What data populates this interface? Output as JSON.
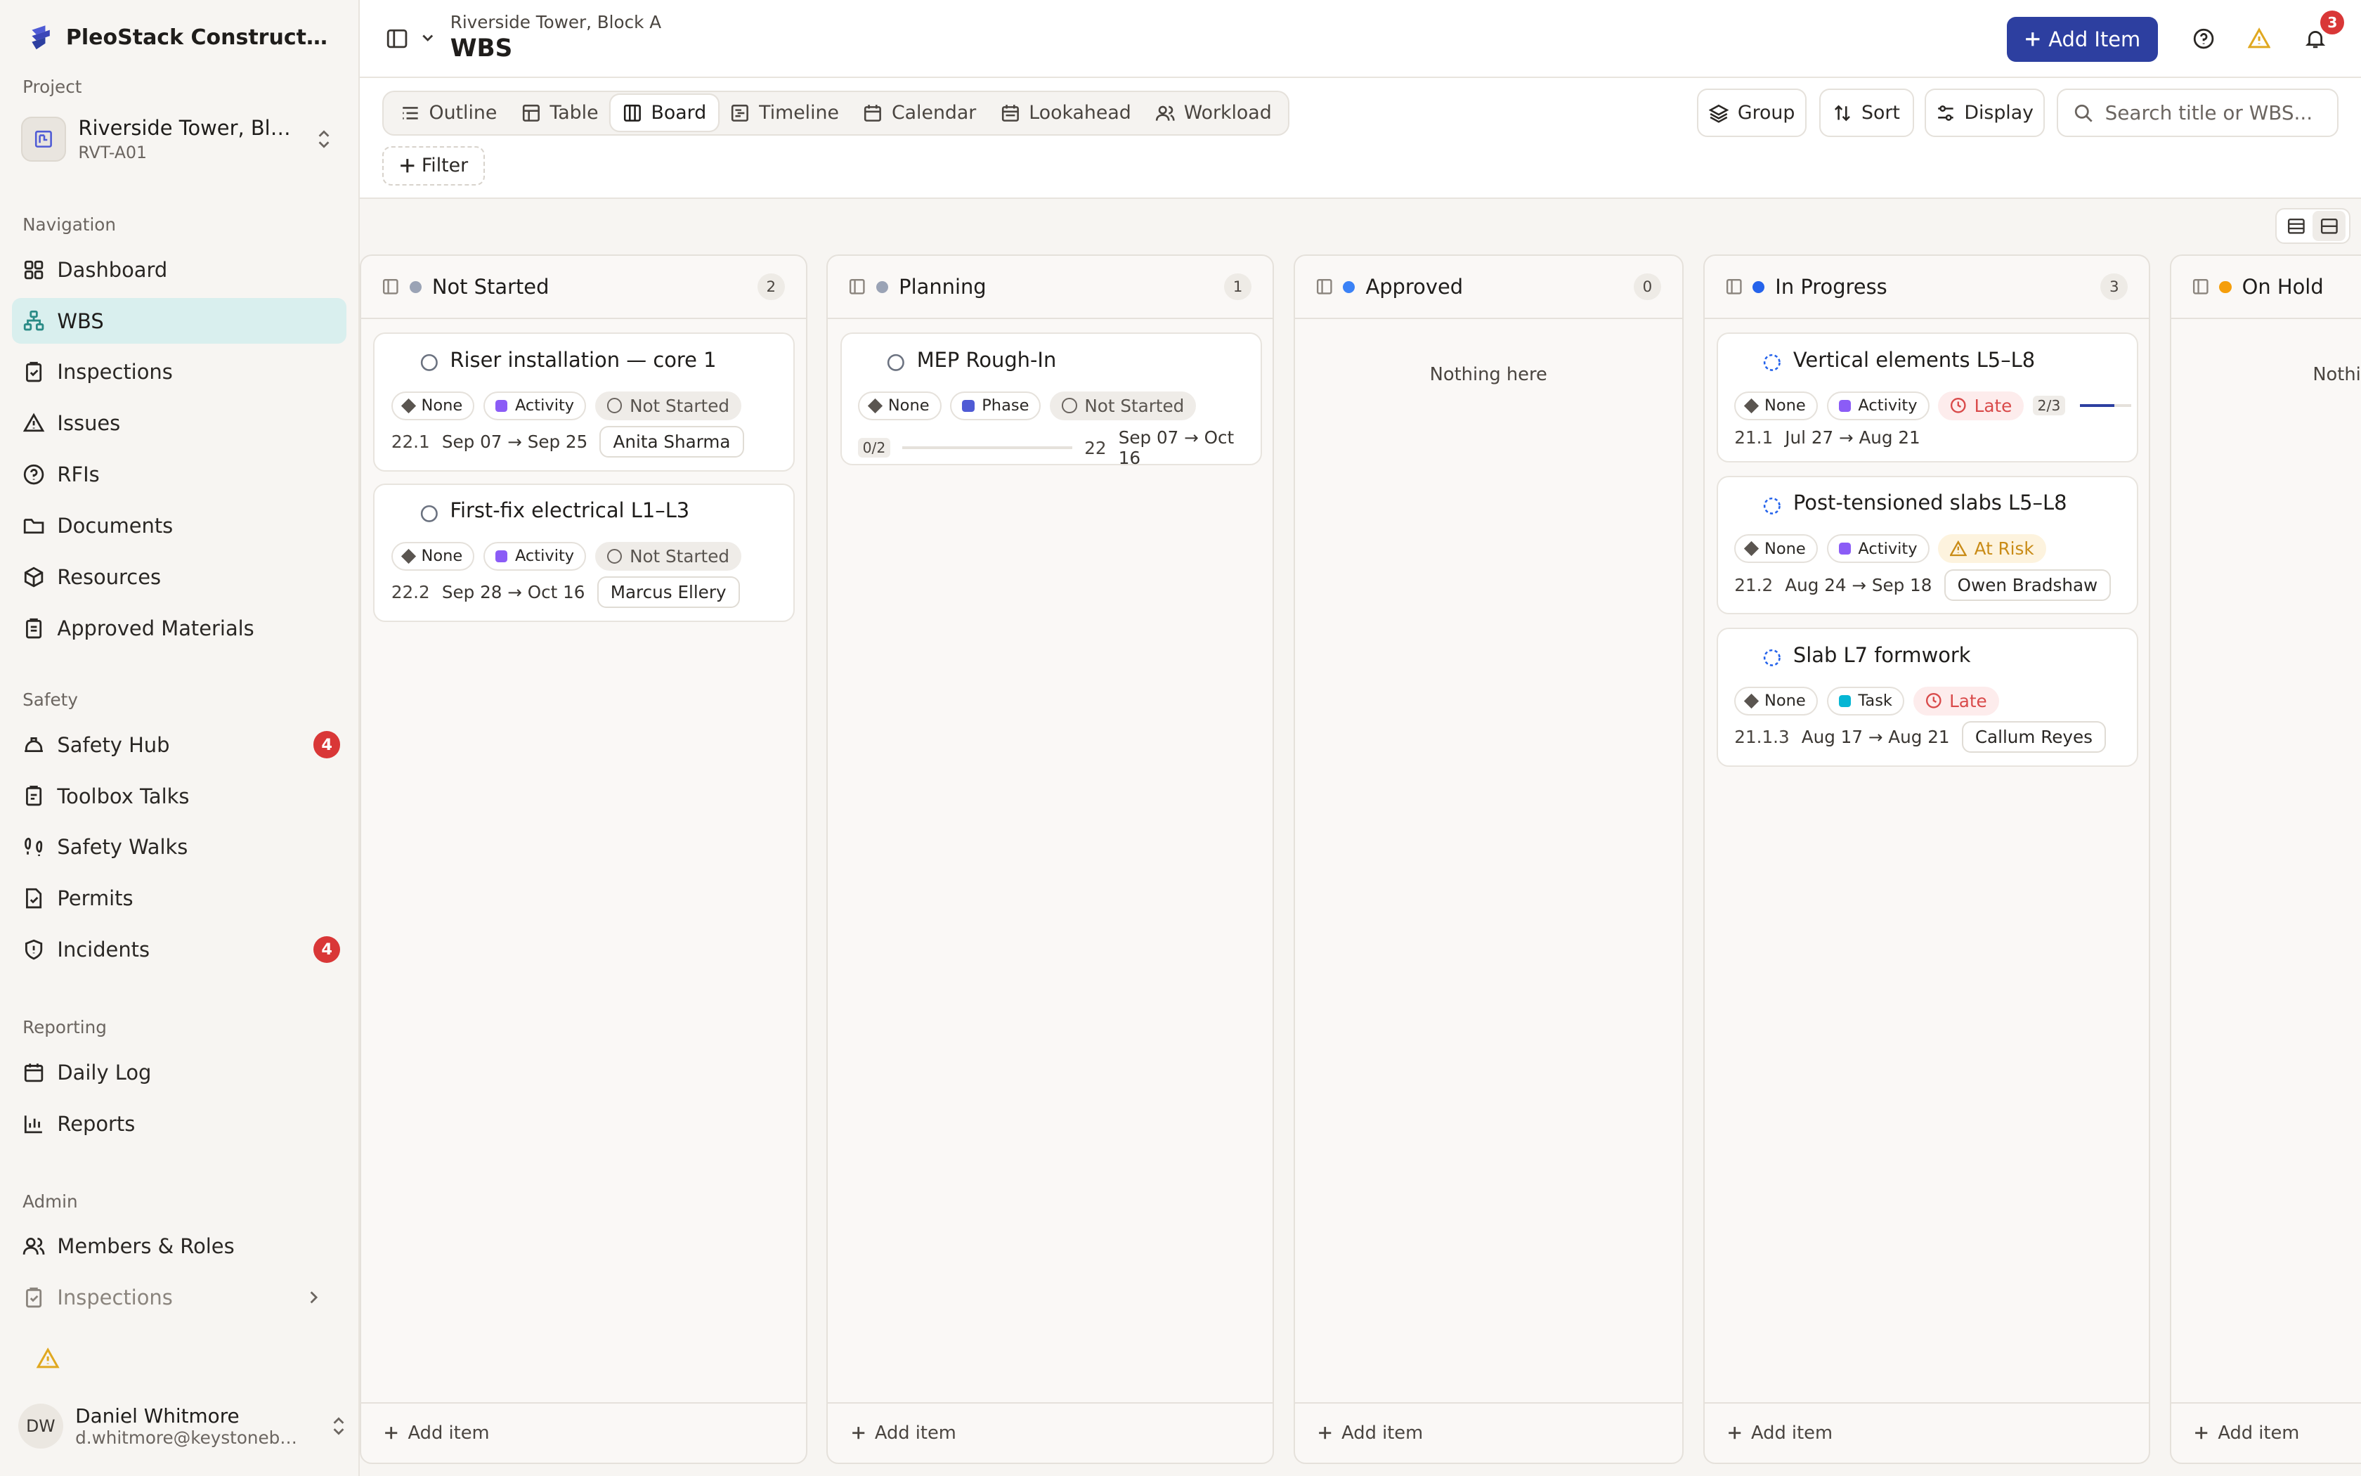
{
  "app": {
    "name": "PleoStack Construction ..."
  },
  "sidebar": {
    "project_label": "Project",
    "project": {
      "name": "Riverside Tower, Bloc...",
      "code": "RVT-A01"
    },
    "groups": [
      {
        "label": "Navigation",
        "items": [
          {
            "label": "Dashboard"
          },
          {
            "label": "WBS"
          },
          {
            "label": "Inspections"
          },
          {
            "label": "Issues"
          },
          {
            "label": "RFIs"
          },
          {
            "label": "Documents"
          },
          {
            "label": "Resources"
          },
          {
            "label": "Approved Materials"
          }
        ]
      },
      {
        "label": "Safety",
        "items": [
          {
            "label": "Safety Hub",
            "badge": "4"
          },
          {
            "label": "Toolbox Talks"
          },
          {
            "label": "Safety Walks"
          },
          {
            "label": "Permits"
          },
          {
            "label": "Incidents",
            "badge": "4"
          }
        ]
      },
      {
        "label": "Reporting",
        "items": [
          {
            "label": "Daily Log"
          },
          {
            "label": "Reports"
          }
        ]
      },
      {
        "label": "Admin",
        "items": [
          {
            "label": "Members & Roles"
          },
          {
            "label": "Inspections"
          }
        ]
      }
    ],
    "user": {
      "initials": "DW",
      "name": "Daniel Whitmore",
      "email": "d.whitmore@keystonebuil..."
    }
  },
  "header": {
    "breadcrumb": "Riverside Tower, Block A",
    "title": "WBS",
    "add_item_label": "Add Item",
    "notification_count": "3"
  },
  "toolbar": {
    "views": [
      "Outline",
      "Table",
      "Board",
      "Timeline",
      "Calendar",
      "Lookahead",
      "Workload"
    ],
    "active_view": "Board",
    "group_label": "Group",
    "sort_label": "Sort",
    "display_label": "Display",
    "search_placeholder": "Search title or WBS...",
    "filter_label": "Filter"
  },
  "board": {
    "add_item_label": "Add item",
    "empty_label": "Nothing here",
    "columns": [
      {
        "title": "Not Started",
        "count": "2",
        "color": "#9aa3b5",
        "cards": [
          {
            "title": "Riser installation — core 1",
            "priority": "None",
            "type": "Activity",
            "type_color": "#8b5cf6",
            "status": "Not Started",
            "wbs": "22.1",
            "dates": "Sep 07 → Sep 25",
            "assignee": "Anita Sharma"
          },
          {
            "title": "First-fix electrical L1–L3",
            "priority": "None",
            "type": "Activity",
            "type_color": "#8b5cf6",
            "status": "Not Started",
            "wbs": "22.2",
            "dates": "Sep 28 → Oct 16",
            "assignee": "Marcus Ellery"
          }
        ]
      },
      {
        "title": "Planning",
        "count": "1",
        "color": "#9aa3b5",
        "cards": [
          {
            "title": "MEP Rough-In",
            "priority": "None",
            "type": "Phase",
            "type_color": "#4f5bd5",
            "status": "Not Started",
            "progress": "0/2",
            "progress_fraction": 0,
            "wbs": "22",
            "dates": "Sep 07 → Oct 16"
          }
        ]
      },
      {
        "title": "Approved",
        "count": "0",
        "color": "#3b82f6",
        "cards": []
      },
      {
        "title": "In Progress",
        "count": "3",
        "color": "#2563eb",
        "cards": [
          {
            "title": "Vertical elements L5–L8",
            "priority": "None",
            "type": "Activity",
            "type_color": "#8b5cf6",
            "flag": "Late",
            "progress": "2/3",
            "progress_fraction": 0.67,
            "wbs": "21.1",
            "dates": "Jul 27 → Aug 21"
          },
          {
            "title": "Post-tensioned slabs L5–L8",
            "priority": "None",
            "type": "Activity",
            "type_color": "#8b5cf6",
            "flag": "At Risk",
            "wbs": "21.2",
            "dates": "Aug 24 → Sep 18",
            "assignee": "Owen Bradshaw"
          },
          {
            "title": "Slab L7 formwork",
            "priority": "None",
            "type": "Task",
            "type_color": "#06b6d4",
            "flag": "Late",
            "wbs": "21.1.3",
            "dates": "Aug 17 → Aug 21",
            "assignee": "Callum Reyes"
          }
        ]
      },
      {
        "title": "On Hold",
        "count": "",
        "color": "#f59e0b",
        "cards": [],
        "empty_partial": "Nothin"
      }
    ]
  }
}
